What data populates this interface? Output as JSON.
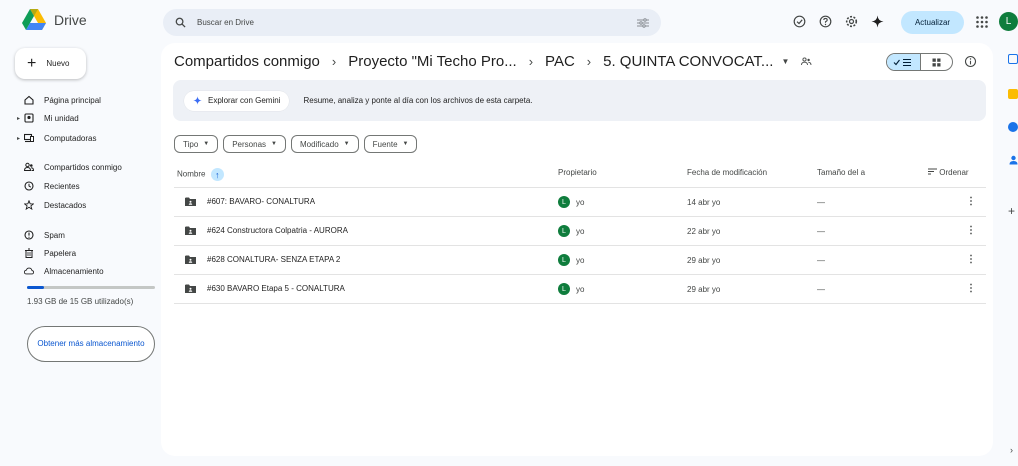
{
  "app": {
    "name": "Drive"
  },
  "search": {
    "placeholder": "Buscar en Drive"
  },
  "header": {
    "update_label": "Actualizar",
    "avatar_letter": "L",
    "icons": [
      "offline-status-icon",
      "help-icon",
      "settings-icon",
      "gemini-sparkle-icon",
      "apps-grid-icon"
    ]
  },
  "sidebar": {
    "new_label": "Nuevo",
    "items": [
      {
        "label": "Página principal",
        "icon": "home-icon"
      },
      {
        "label": "Mi unidad",
        "icon": "my-drive-icon"
      },
      {
        "label": "Computadoras",
        "icon": "computer-icon"
      },
      {
        "label": "Compartidos conmigo",
        "icon": "shared-people-icon"
      },
      {
        "label": "Recientes",
        "icon": "clock-icon"
      },
      {
        "label": "Destacados",
        "icon": "star-icon"
      },
      {
        "label": "Spam",
        "icon": "spam-icon"
      },
      {
        "label": "Papelera",
        "icon": "trash-icon"
      },
      {
        "label": "Almacenamiento",
        "icon": "cloud-icon"
      }
    ],
    "storage": {
      "used_text": "1.93 GB de 15 GB utilizado(s)",
      "used_fraction": 0.13,
      "more_label": "Obtener más almacenamiento"
    }
  },
  "breadcrumb": {
    "items": [
      "Compartidos conmigo",
      "Proyecto \"Mi Techo Pro...",
      "PAC",
      "5. QUINTA CONVOCAT..."
    ],
    "separator": "›"
  },
  "gemini": {
    "button_label": "Explorar con Gemini",
    "description": "Resume, analiza y ponte al día con los archivos de esta carpeta."
  },
  "filters": [
    "Tipo",
    "Personas",
    "Modificado",
    "Fuente"
  ],
  "table": {
    "columns": {
      "name": "Nombre",
      "owner": "Propietario",
      "modified": "Fecha de modificación",
      "size": "Tamaño del a",
      "sort": "Ordenar"
    },
    "rows": [
      {
        "name": "#607: BAVARO- CONALTURA",
        "owner": "yo",
        "owner_initial": "L",
        "modified": "14 abr yo",
        "size": "—"
      },
      {
        "name": "#624 Constructora Colpatria - AURORA",
        "owner": "yo",
        "owner_initial": "L",
        "modified": "22 abr yo",
        "size": "—"
      },
      {
        "name": "#628 CONALTURA- SENZA ETAPA 2",
        "owner": "yo",
        "owner_initial": "L",
        "modified": "29 abr yo",
        "size": "—"
      },
      {
        "name": "#630 BAVARO Etapa 5 - CONALTURA",
        "owner": "yo",
        "owner_initial": "L",
        "modified": "29 abr yo",
        "size": "—"
      }
    ]
  },
  "colors": {
    "accent": "#0b57d0",
    "accent_light": "#c2e7ff",
    "avatar": "#0f7d3d",
    "background": "#f8fafd"
  }
}
